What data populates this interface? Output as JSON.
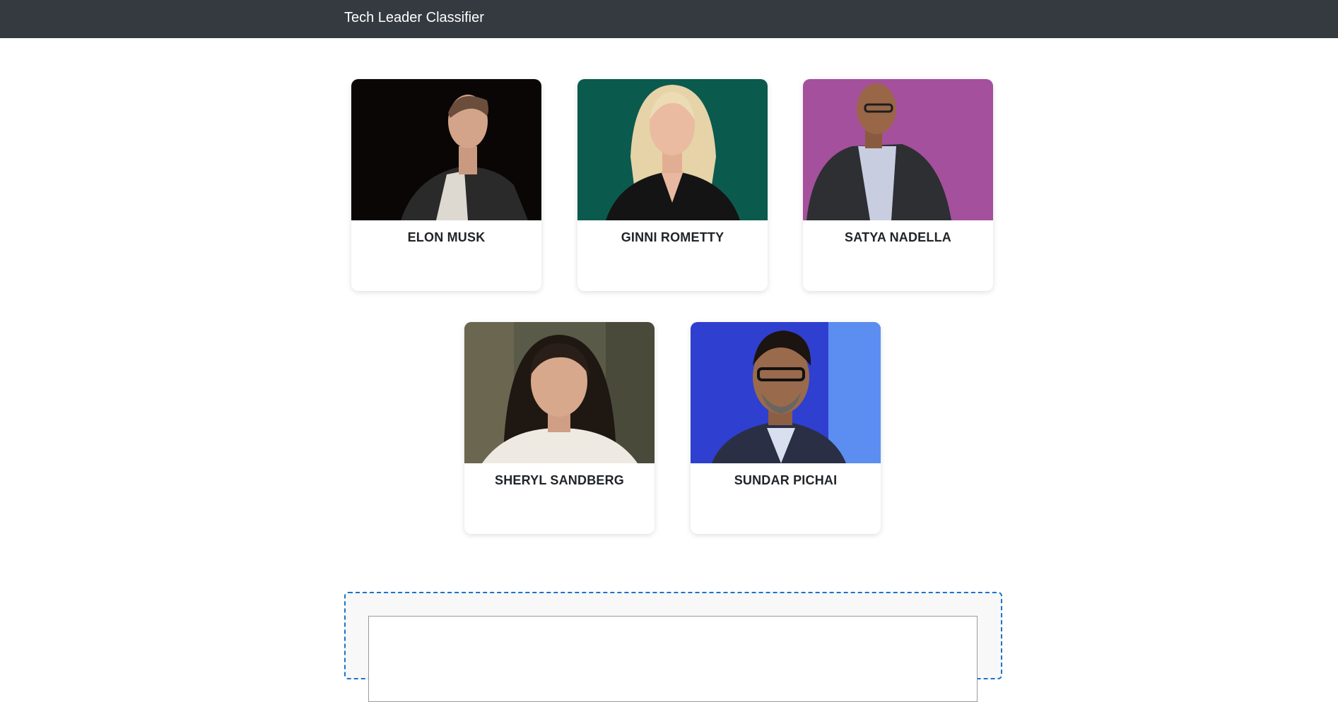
{
  "navbar": {
    "brand": "Tech Leader Classifier"
  },
  "cards": [
    {
      "name": "ELON MUSK",
      "bg": "#0b0606"
    },
    {
      "name": "GINNI ROMETTY",
      "bg": "#0b5a4e"
    },
    {
      "name": "SATYA NADELLA",
      "bg": "#a4509c"
    },
    {
      "name": "SHERYL SANDBERG",
      "bg": "#5a5a48"
    },
    {
      "name": "SUNDAR PICHAI",
      "bg": "#2f3fd0"
    }
  ],
  "colors": {
    "navbar": "#343a40",
    "dropzone_border": "#1a73c9"
  }
}
